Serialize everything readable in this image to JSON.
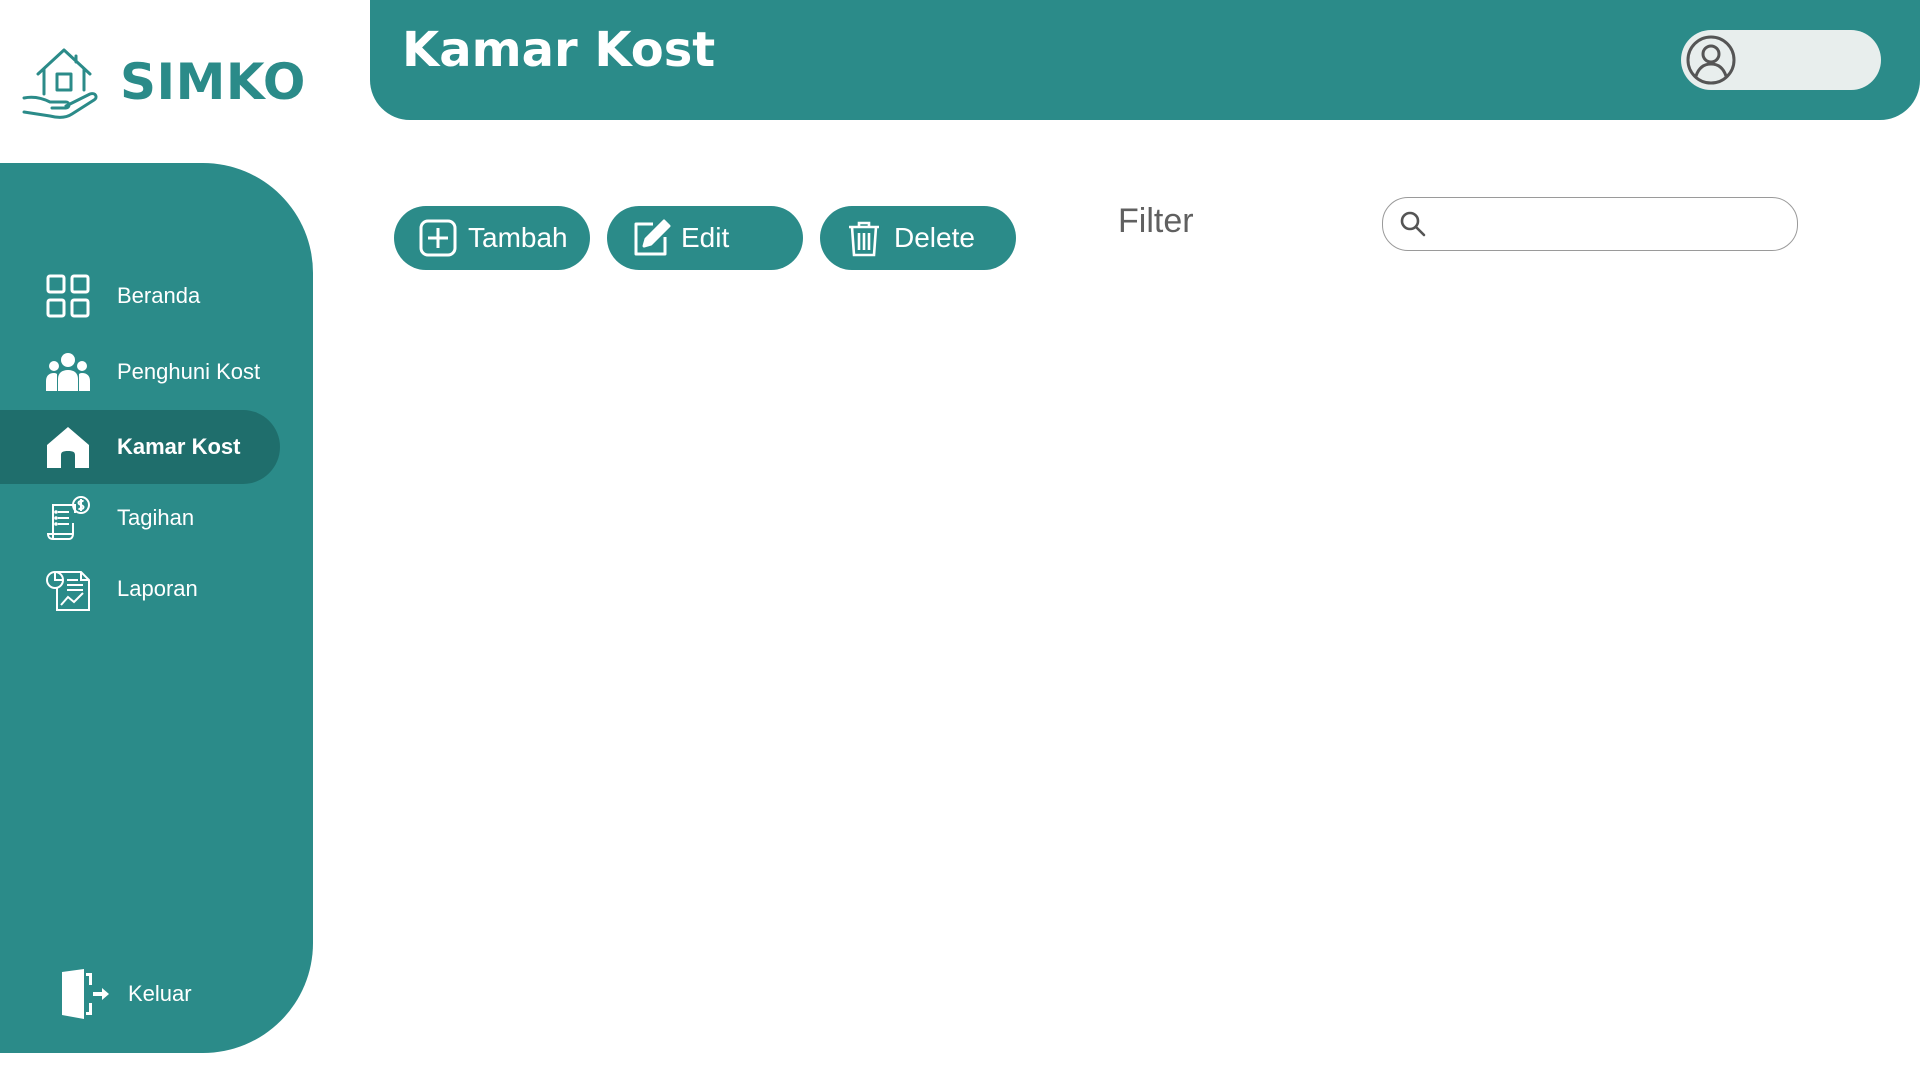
{
  "app": {
    "name": "SIMKO"
  },
  "header": {
    "title": "Kamar Kost"
  },
  "sidebar": {
    "items": [
      {
        "label": "Beranda",
        "icon": "dashboard-icon"
      },
      {
        "label": "Penghuni Kost",
        "icon": "users-icon"
      },
      {
        "label": "Kamar Kost",
        "icon": "home-icon",
        "active": true
      },
      {
        "label": "Tagihan",
        "icon": "invoice-icon"
      },
      {
        "label": "Laporan",
        "icon": "report-icon"
      }
    ],
    "logout_label": "Keluar"
  },
  "toolbar": {
    "add_label": "Tambah",
    "edit_label": "Edit",
    "delete_label": "Delete",
    "filter_label": "Filter"
  },
  "search": {
    "value": "",
    "placeholder": ""
  },
  "colors": {
    "primary": "#2b8b89",
    "active": "#1f6e6c",
    "background": "#ffffff"
  }
}
